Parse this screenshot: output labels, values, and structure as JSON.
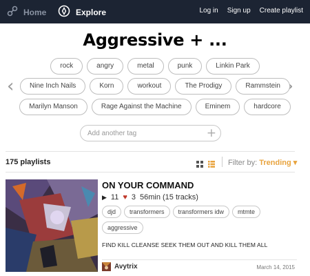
{
  "nav": {
    "home_label": "Home",
    "explore_label": "Explore",
    "login_label": "Log in",
    "signup_label": "Sign up",
    "create_label": "Create playlist"
  },
  "page": {
    "title": "Aggressive + ..."
  },
  "tags": {
    "row1": [
      "rock",
      "angry",
      "metal",
      "punk",
      "Linkin Park"
    ],
    "row2": [
      "Nine Inch Nails",
      "Korn",
      "workout",
      "The Prodigy",
      "Rammstein"
    ],
    "row3": [
      "Marilyn Manson",
      "Rage Against the Machine",
      "Eminem",
      "hardcore"
    ]
  },
  "add_tag": {
    "placeholder": "Add another tag"
  },
  "toolbar": {
    "count": "175 playlists",
    "filter_label": "Filter by:",
    "filter_value": "Trending ▾"
  },
  "playlist": {
    "title": "ON YOUR COMMAND",
    "plays": "11",
    "likes": "3",
    "duration": "56min (15 tracks)",
    "tags_row1": [
      "djd",
      "transformers",
      "transformers idw",
      "mtmte"
    ],
    "tags_row2": [
      "aggressive"
    ],
    "description": "FIND KILL CLEANSE SEEK THEM OUT AND KILL THEM ALL",
    "author": "Avytrix",
    "date": "March 14, 2015"
  },
  "icons": {
    "home": "home-icon",
    "explore": "compass-icon",
    "prev": "chevron-left-icon",
    "next": "chevron-right-icon",
    "plus": "plus-icon",
    "grid": "grid-view-icon",
    "list": "list-view-icon",
    "play": "play-icon",
    "heart": "heart-icon"
  },
  "colors": {
    "nav_bg": "#1c2433",
    "accent": "#e8a33d",
    "heart": "#c0392b"
  }
}
